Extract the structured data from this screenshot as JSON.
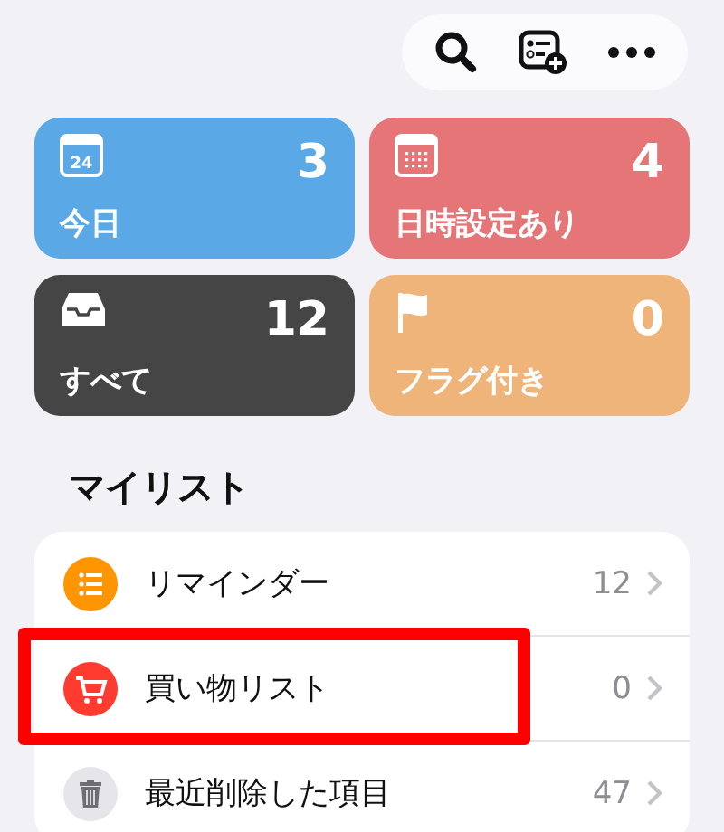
{
  "toolbar": {
    "buttons": [
      {
        "kind": "search"
      },
      {
        "kind": "add-list"
      },
      {
        "kind": "more"
      }
    ]
  },
  "smart_lists": [
    {
      "kind": "today",
      "label": "今日",
      "count": "3",
      "icon_text": "24",
      "color": "#5aa9e6"
    },
    {
      "kind": "scheduled",
      "label": "日時設定あり",
      "count": "4",
      "color": "#e67577"
    },
    {
      "kind": "all",
      "label": "すべて",
      "count": "12",
      "color": "#454545"
    },
    {
      "kind": "flagged",
      "label": "フラグ付き",
      "count": "0",
      "color": "#efb47a"
    }
  ],
  "my_lists": {
    "title": "マイリスト",
    "items": [
      {
        "kind": "list",
        "name": "リマインダー",
        "count": "12",
        "color": "#ff9500",
        "highlighted": false
      },
      {
        "kind": "cart",
        "name": "買い物リスト",
        "count": "0",
        "color": "#ff3b30",
        "highlighted": true
      },
      {
        "kind": "trash",
        "name": "最近削除した項目",
        "count": "47",
        "color": "#e5e5ea",
        "highlighted": false
      }
    ]
  }
}
